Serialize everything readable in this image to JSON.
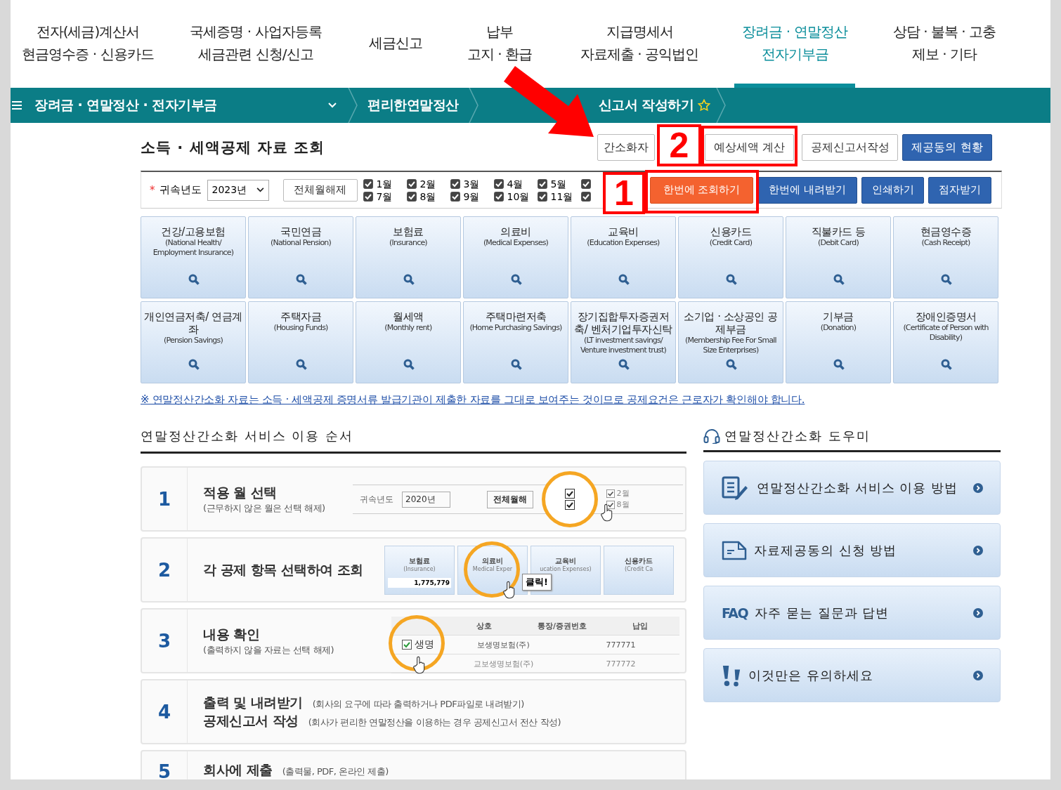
{
  "top_nav": [
    {
      "lines": [
        "전자(세금)계산서",
        "현금영수증 · 신용카드"
      ],
      "selected": false
    },
    {
      "lines": [
        "국세증명 · 사업자등록",
        "세금관련 신청/신고"
      ],
      "selected": false
    },
    {
      "lines": [
        "세금신고"
      ],
      "selected": false
    },
    {
      "lines": [
        "납부",
        "고지 · 환급"
      ],
      "selected": false
    },
    {
      "lines": [
        "지급명세서",
        "자료제출 · 공익법인"
      ],
      "selected": false
    },
    {
      "lines": [
        "장려금 · 연말정산",
        "전자기부금"
      ],
      "selected": true
    },
    {
      "lines": [
        "상담 · 불복 · 고충",
        "제보 · 기타"
      ],
      "selected": false
    }
  ],
  "breadcrumb": [
    {
      "label": "장려금 · 연말정산 · 전자기부금",
      "kind": "dropdown"
    },
    {
      "label": "편리한연말정산",
      "kind": "link"
    },
    {
      "label": "신고서 작성하기",
      "kind": "current"
    }
  ],
  "section_title": "소득 · 세액공제 자료 조회",
  "top_buttons": [
    {
      "label": "간소화자",
      "kind": "outline"
    },
    {
      "label": "예상세액 계산",
      "kind": "outline"
    },
    {
      "label": "공제신고서작성",
      "kind": "outline"
    },
    {
      "label": "제공동의 현황",
      "kind": "primary"
    }
  ],
  "filter": {
    "required_mark": "*",
    "year_label": "귀속년도",
    "year_value": "2023년",
    "clear_button": "전체월해제",
    "months": [
      {
        "label": "1월",
        "checked": true
      },
      {
        "label": "2월",
        "checked": true
      },
      {
        "label": "3월",
        "checked": true
      },
      {
        "label": "4월",
        "checked": true
      },
      {
        "label": "5월",
        "checked": true
      },
      {
        "checked": true
      },
      {
        "label": "7월",
        "checked": true
      },
      {
        "label": "8월",
        "checked": true
      },
      {
        "label": "9월",
        "checked": true
      },
      {
        "label": "10월",
        "checked": true
      },
      {
        "label": "11월",
        "checked": true
      },
      {
        "checked": true
      }
    ],
    "buttons": [
      {
        "label": "한번에 조회하기",
        "kind": "orange"
      },
      {
        "label": "한번에 내려받기",
        "kind": "primary"
      },
      {
        "label": "인쇄하기",
        "kind": "primary"
      },
      {
        "label": "점자받기",
        "kind": "primary"
      }
    ]
  },
  "tiles": [
    {
      "title": "건강/고용보험",
      "subtitle": "(National Health/ Employment Insurance)"
    },
    {
      "title": "국민연금",
      "subtitle": "(National Pension)"
    },
    {
      "title": "보험료",
      "subtitle": "(Insurance)"
    },
    {
      "title": "의료비",
      "subtitle": "(Medical Expenses)"
    },
    {
      "title": "교육비",
      "subtitle": "(Education Expenses)"
    },
    {
      "title": "신용카드",
      "subtitle": "(Credit Card)"
    },
    {
      "title": "직불카드 등",
      "subtitle": "(Debit Card)"
    },
    {
      "title": "현금영수증",
      "subtitle": "(Cash Receipt)"
    },
    {
      "title": "개인연금저축/ 연금계좌",
      "subtitle": "(Pension Savings)"
    },
    {
      "title": "주택자금",
      "subtitle": "(Housing Funds)"
    },
    {
      "title": "월세액",
      "subtitle": "(Monthly rent)"
    },
    {
      "title": "주택마련저축",
      "subtitle": "(Home Purchasing Savings)"
    },
    {
      "title": "장기집합투자증권저축/ 벤처기업투자신탁",
      "subtitle": "(LT investment savings/ Venture investment trust)"
    },
    {
      "title": "소기업 · 소상공인 공제부금",
      "subtitle": "(Membership Fee For Small Size Enterprises)"
    },
    {
      "title": "기부금",
      "subtitle": "(Donation)"
    },
    {
      "title": "장애인증명서",
      "subtitle": "(Certificate of Person with Disability)"
    }
  ],
  "notice": "※ 연말정산간소화 자료는 소득 · 세액공제 증명서류 발급기관이 제출한 자료를 그대로 보여주는 것이므로 공제요건은 근로자가 확인해야 합니다.",
  "steps_panel": {
    "title": "연말정산간소화 서비스 이용 순서",
    "steps": [
      {
        "number": "1",
        "kind": "stacked",
        "lines": [
          {
            "title": "적용 월 선택",
            "note": "(근무하지 않은 월은 선택 해제)"
          }
        ],
        "demo": {
          "kind": "months",
          "year_label": "귀속년도",
          "year_value": "2020년",
          "clear_button": "전체월해",
          "months": [
            {
              "checked": true
            },
            {
              "checked": true
            },
            {
              "label": "2월",
              "checked": true
            },
            {
              "label": "8월",
              "checked": true
            }
          ]
        }
      },
      {
        "number": "2",
        "kind": "stacked",
        "lines": [
          {
            "title": "각 공제 항목 선택하여 조회"
          }
        ],
        "demo": {
          "kind": "tiles",
          "tiles": [
            {
              "title": "보험료",
              "subtitle": "(Insurance)",
              "value": "1,775,779"
            },
            {
              "title": "의료비",
              "subtitle": "Medical Exper"
            },
            {
              "title": "교육비",
              "subtitle": "ucation Expenses)"
            },
            {
              "title": "신용카드",
              "subtitle": "(Credit Ca"
            }
          ],
          "callout": "클릭!"
        }
      },
      {
        "number": "3",
        "kind": "stacked",
        "lines": [
          {
            "title": "내용 확인",
            "note": "(출력하지 않을 자료는 선택 해제)"
          }
        ],
        "demo": {
          "kind": "table",
          "headers": [
            "상호",
            "통장/증권번호",
            "납입"
          ],
          "rows": [
            {
              "checked": true,
              "cells": [
                "생명",
                "보생명보험(주)",
                "777771"
              ]
            },
            {
              "cells": [
                "",
                "교보생명보험(주)",
                "777772"
              ]
            }
          ]
        }
      },
      {
        "number": "4",
        "kind": "inline",
        "lines": [
          {
            "title": "출력 및 내려받기",
            "note": "(회사의 요구에 따라 출력하거나 PDF파일로 내려받기)"
          },
          {
            "title": "공제신고서 작성",
            "note": "(회사가 편리한 연말정산을 이용하는 경우 공제신고서 전산 작성)"
          }
        ]
      },
      {
        "number": "5",
        "kind": "inline",
        "lines": [
          {
            "title": "회사에 제출",
            "note": "(출력물, PDF, 온라인 제출)"
          }
        ]
      }
    ]
  },
  "helper_panel": {
    "title": "연말정산간소화 도우미",
    "items": [
      {
        "kind": "form",
        "label": "연말정산간소화 서비스 이용 방법"
      },
      {
        "kind": "letter",
        "label": "자료제공동의 신청 방법"
      },
      {
        "kind": "faq",
        "badge": "FAQ",
        "label": "자주 묻는 질문과 답변"
      },
      {
        "kind": "alert",
        "label": "이것만은 유의하세요"
      }
    ]
  },
  "annotations": [
    {
      "label": "1"
    },
    {
      "label": "2"
    }
  ]
}
